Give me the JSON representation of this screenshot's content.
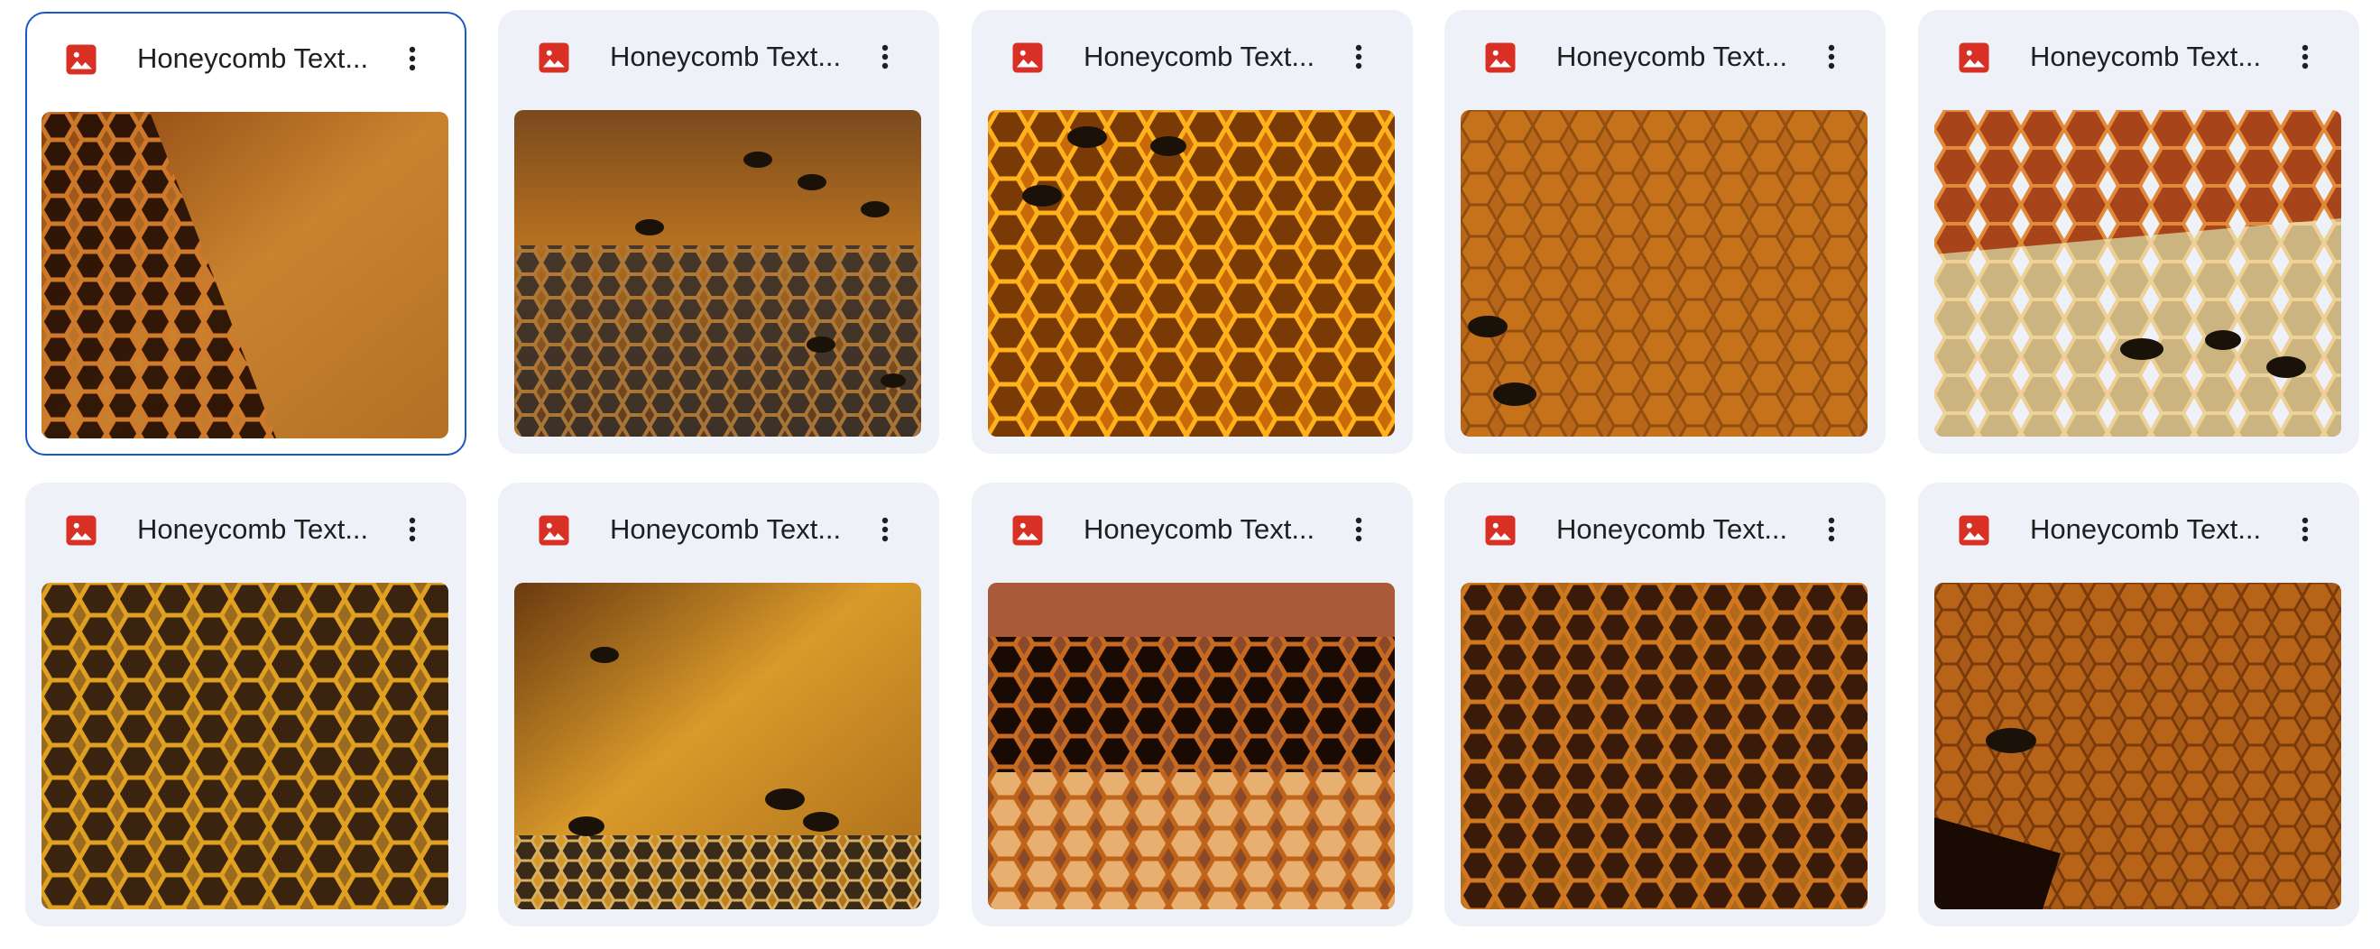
{
  "colors": {
    "card_bg": "#eef2f8",
    "selected_border": "#1a57c9",
    "image_icon_red": "#d93025",
    "title_text": "#1f1f1f"
  },
  "files": [
    {
      "name": "Honeycomb Text...",
      "icon": "image-file-icon",
      "selected": true
    },
    {
      "name": "Honeycomb Text...",
      "icon": "image-file-icon",
      "selected": false
    },
    {
      "name": "Honeycomb Text...",
      "icon": "image-file-icon",
      "selected": false
    },
    {
      "name": "Honeycomb Text...",
      "icon": "image-file-icon",
      "selected": false
    },
    {
      "name": "Honeycomb Text...",
      "icon": "image-file-icon",
      "selected": false
    },
    {
      "name": "Honeycomb Text...",
      "icon": "image-file-icon",
      "selected": false
    },
    {
      "name": "Honeycomb Text...",
      "icon": "image-file-icon",
      "selected": false
    },
    {
      "name": "Honeycomb Text...",
      "icon": "image-file-icon",
      "selected": false
    },
    {
      "name": "Honeycomb Text...",
      "icon": "image-file-icon",
      "selected": false
    },
    {
      "name": "Honeycomb Text...",
      "icon": "image-file-icon",
      "selected": false
    }
  ],
  "more_icon": "more-vert-icon"
}
